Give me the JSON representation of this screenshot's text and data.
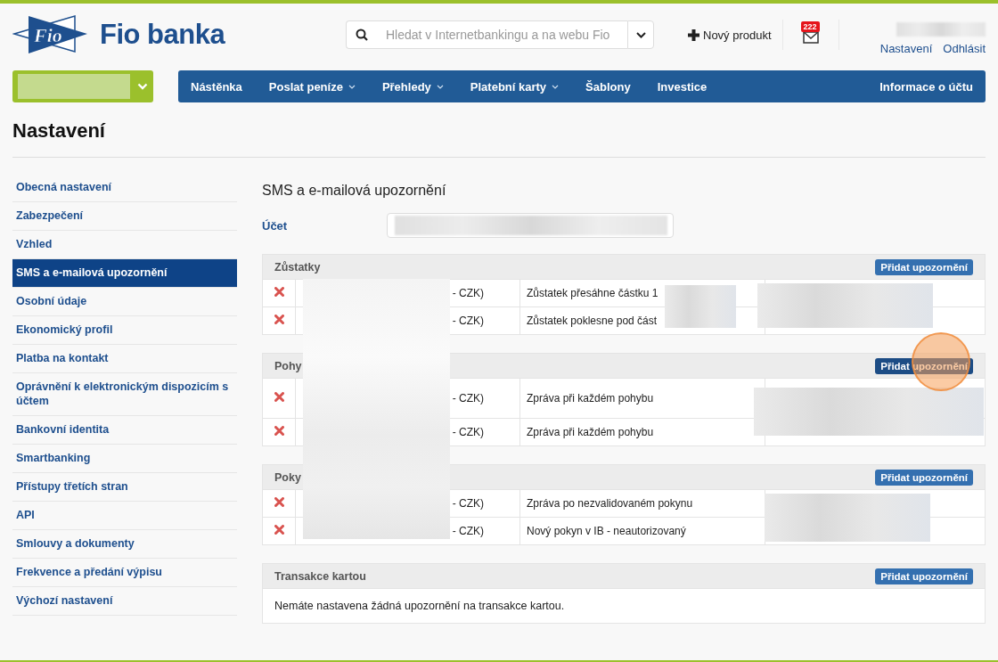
{
  "logo": {
    "mark": "Fio",
    "name": "Fio banka"
  },
  "search": {
    "placeholder": "Hledat v Internetbankingu a na webu Fio"
  },
  "new_product": "Nový produkt",
  "mail_badge": "222",
  "user_links": [
    "Nastavení",
    "Odhlásit"
  ],
  "nav": [
    {
      "label": "Nástěnka",
      "dropdown": false
    },
    {
      "label": "Poslat peníze",
      "dropdown": true
    },
    {
      "label": "Přehledy",
      "dropdown": true
    },
    {
      "label": "Platební karty",
      "dropdown": true
    },
    {
      "label": "Šablony",
      "dropdown": false
    },
    {
      "label": "Investice",
      "dropdown": false
    }
  ],
  "nav_right": "Informace o účtu",
  "page_title": "Nastavení",
  "sidebar": [
    {
      "label": "Obecná nastavení",
      "selected": false
    },
    {
      "label": "Zabezpečení",
      "selected": false
    },
    {
      "label": "Vzhled",
      "selected": false
    },
    {
      "label": "SMS a e-mailová upozornění",
      "selected": true
    },
    {
      "label": "Osobní údaje",
      "selected": false
    },
    {
      "label": "Ekonomický profil",
      "selected": false
    },
    {
      "label": "Platba na kontakt",
      "selected": false
    },
    {
      "label": "Oprávnění k elektronickým dispozicím s účtem",
      "selected": false
    },
    {
      "label": "Bankovní identita",
      "selected": false
    },
    {
      "label": "Smartbanking",
      "selected": false
    },
    {
      "label": "Přístupy třetích stran",
      "selected": false
    },
    {
      "label": "API",
      "selected": false
    },
    {
      "label": "Smlouvy a dokumenty",
      "selected": false
    },
    {
      "label": "Frekvence a předání výpisu",
      "selected": false
    },
    {
      "label": "Výchozí nastavení",
      "selected": false
    }
  ],
  "content_title": "SMS a e-mailová upozornění",
  "account_label": "Účet",
  "sections": [
    {
      "title": "Zůstatky",
      "button": "Přidat upozornění",
      "hovered": false,
      "rows": [
        {
          "account": "- CZK)",
          "type": "Zůstatek přesáhne částku 1"
        },
        {
          "account": "- CZK)",
          "type": "Zůstatek poklesne pod část"
        }
      ]
    },
    {
      "title": "Pohy",
      "button": "Přidat upozornění",
      "hovered": true,
      "rows": [
        {
          "account": "- CZK)",
          "type": "Zpráva při každém pohybu"
        },
        {
          "account": "- CZK)",
          "type": "Zpráva při každém pohybu"
        }
      ]
    },
    {
      "title": "Poky",
      "button": "Přidat upozornění",
      "hovered": false,
      "rows": [
        {
          "account": "- CZK)",
          "type": "Zpráva po nezvalidovaném pokynu"
        },
        {
          "account": "- CZK)",
          "type": "Nový pokyn v IB - neautorizovaný"
        }
      ]
    },
    {
      "title": "Transakce kartou",
      "button": "Přidat upozornění",
      "hovered": false,
      "empty_text": "Nemáte nastavena žádná upozornění na transakce kartou."
    }
  ]
}
